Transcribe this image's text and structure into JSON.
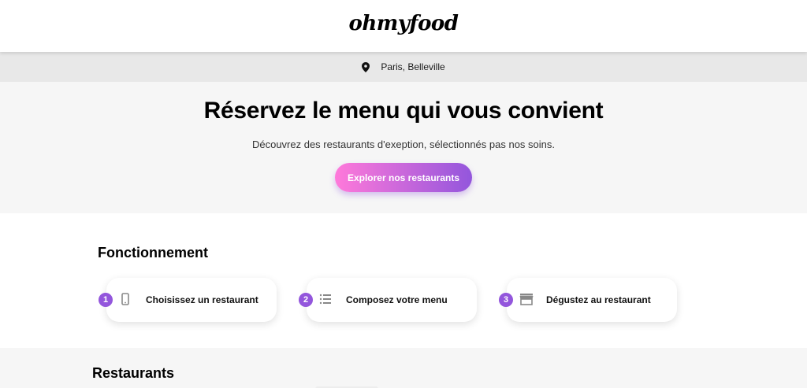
{
  "header": {
    "logo": "ohmyfood"
  },
  "location": {
    "icon": "map-pin-icon",
    "text": "Paris, Belleville"
  },
  "hero": {
    "title": "Réservez le menu qui vous convient",
    "subtitle": "Découvrez des restaurants d'exeption, sélectionnés pas nos soins.",
    "button_label": "Explorer nos restaurants",
    "button_gradient": [
      "#ff79da",
      "#9356dc"
    ]
  },
  "how_it_works": {
    "title": "Fonctionnement",
    "steps": [
      {
        "number": "1",
        "icon": "mobile-phone-icon",
        "label": "Choisissez un restaurant"
      },
      {
        "number": "2",
        "icon": "list-icon",
        "label": "Composez votre menu"
      },
      {
        "number": "3",
        "icon": "store-icon",
        "label": "Dégustez au restaurant"
      }
    ]
  },
  "restaurants": {
    "title": "Restaurants"
  },
  "colors": {
    "accent": "#9356dc",
    "hero_bg": "#f6f6f6",
    "location_bg": "#e8e8e8"
  }
}
